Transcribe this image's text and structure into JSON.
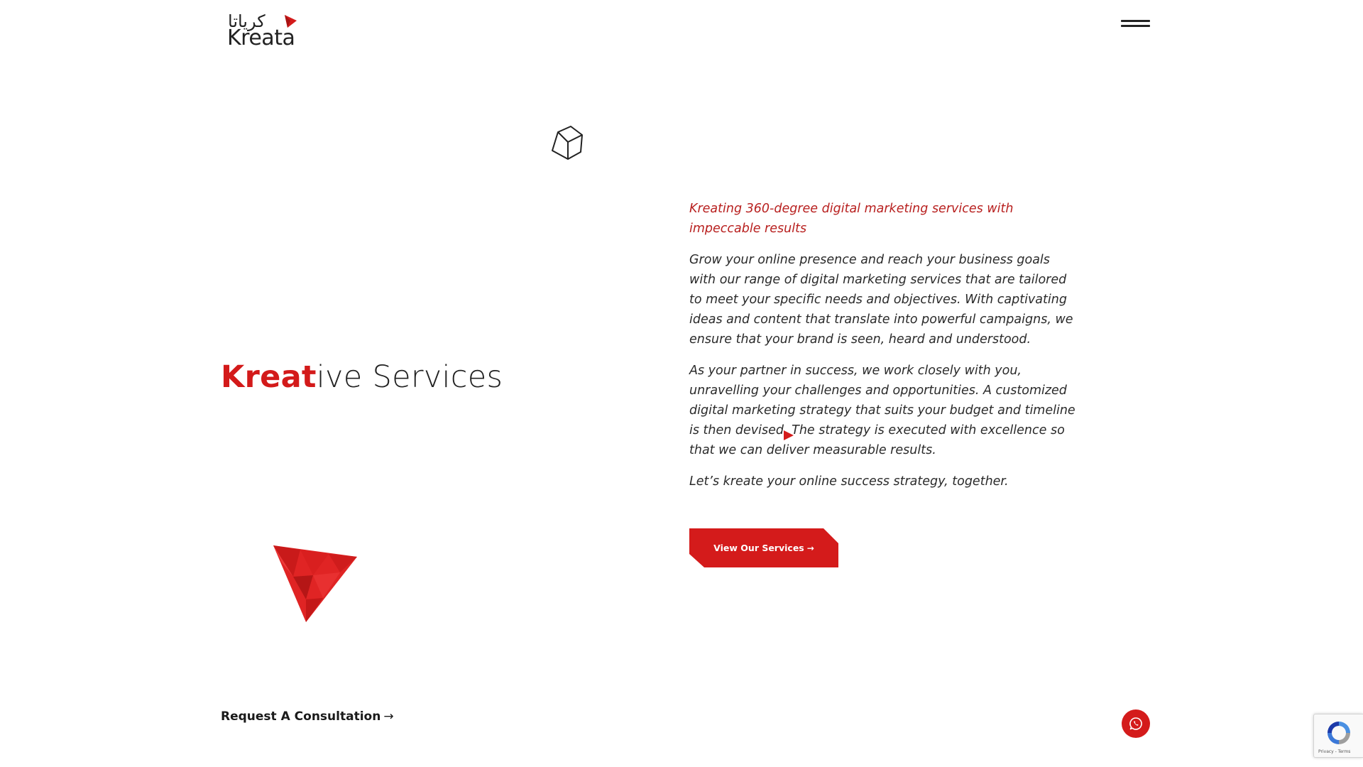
{
  "header": {
    "logo_arabic": "كرياتا",
    "logo_latin": "Kreata",
    "menu_icon": "hamburger-menu-icon"
  },
  "hero": {
    "title_accent": "Kreat",
    "title_rest": "ive Services",
    "decor_icon": "cube-icon",
    "triangle_icon": "brand-triangle-icon"
  },
  "content": {
    "tagline": "Kreating 360-degree digital marketing services with impeccable results",
    "paragraphs": [
      "Grow your online presence and reach your business goals with our range of digital marketing services that are tailored to meet your specific needs and objectives. With captivating ideas and content that translate into powerful campaigns, we ensure that your brand is seen, heard and understood.",
      "As your partner in success, we work closely with you, unravelling your challenges and opportunities. A customized digital marketing strategy that suits your budget and timeline is then devised. The strategy is executed with excellence so that we can deliver measurable results.",
      "Let’s kreate your online success strategy, together."
    ],
    "services_button": "View Our Services",
    "services_button_arrow": "→"
  },
  "footer": {
    "consult_label": "Request A Consultation",
    "consult_arrow": "→",
    "whatsapp_icon": "whatsapp-icon"
  },
  "recaptcha": {
    "text": "Privacy - Terms"
  },
  "colors": {
    "accent": "#d41b1b",
    "tagline": "#b8201f",
    "text": "#2a2a2a"
  }
}
